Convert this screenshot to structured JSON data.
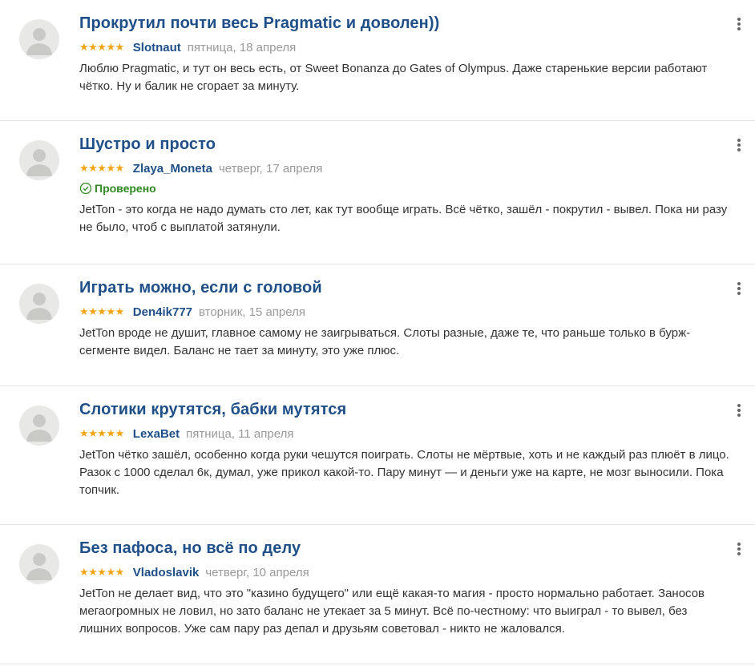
{
  "colors": {
    "title": "#1f4f88",
    "star": "#f3a518",
    "verified": "#2f8a22",
    "date": "#999999"
  },
  "reviews": [
    {
      "title": "Прокрутил почти весь Pragmatic и доволен))",
      "stars": "★★★★★",
      "author": "Slotnaut",
      "date": "пятница, 18 апреля",
      "verified": "",
      "text": "Люблю Pragmatic, и тут он весь есть, от Sweet Bonanza до Gates of Olympus. Даже старенькие версии работают чётко. Ну и балик не сгорает за минуту."
    },
    {
      "title": "Шустро и просто",
      "stars": "★★★★★",
      "author": "Zlaya_Moneta",
      "date": "четверг, 17 апреля",
      "verified": "Проверено",
      "text": "JetTon - это когда не надо думать сто лет, как тут вообще играть. Всё чётко, зашёл - покрутил - вывел. Пока ни разу не было, чтоб с выплатой затянули."
    },
    {
      "title": "Играть можно, если с головой",
      "stars": "★★★★★",
      "author": "Den4ik777",
      "date": "вторник, 15 апреля",
      "verified": "",
      "text": "JetTon вроде не душит, главное самому не заигрываться. Слоты разные, даже те, что раньше только в бурж-сегменте видел. Баланс не тает за минуту, это уже плюс."
    },
    {
      "title": "Слотики крутятся, бабки мутятся",
      "stars": "★★★★★",
      "author": "LexaBet",
      "date": "пятница, 11 апреля",
      "verified": "",
      "text": "JetTon чётко зашёл, особенно когда руки чешутся поиграть. Слоты не мёртвые, хоть и не каждый раз плюёт в лицо. Разок с 1000 сделал 6к, думал, уже прикол какой-то. Пару минут — и деньги уже на карте, не мозг выносили. Пока топчик."
    },
    {
      "title": "Без пафоса, но всё по делу",
      "stars": "★★★★★",
      "author": "Vladoslavik",
      "date": "четверг, 10 апреля",
      "verified": "",
      "text": "JetTon не делает вид, что это \"казино будущего\" или ещё какая-то магия - просто нормально работает. Заносов мегаогромных не ловил, но зато баланс не утекает за 5 минут. Всё по-честному: что выиграл - то вывел, без лишних вопросов. Уже сам пару раз депал и друзьям советовал - никто не жаловался."
    }
  ]
}
